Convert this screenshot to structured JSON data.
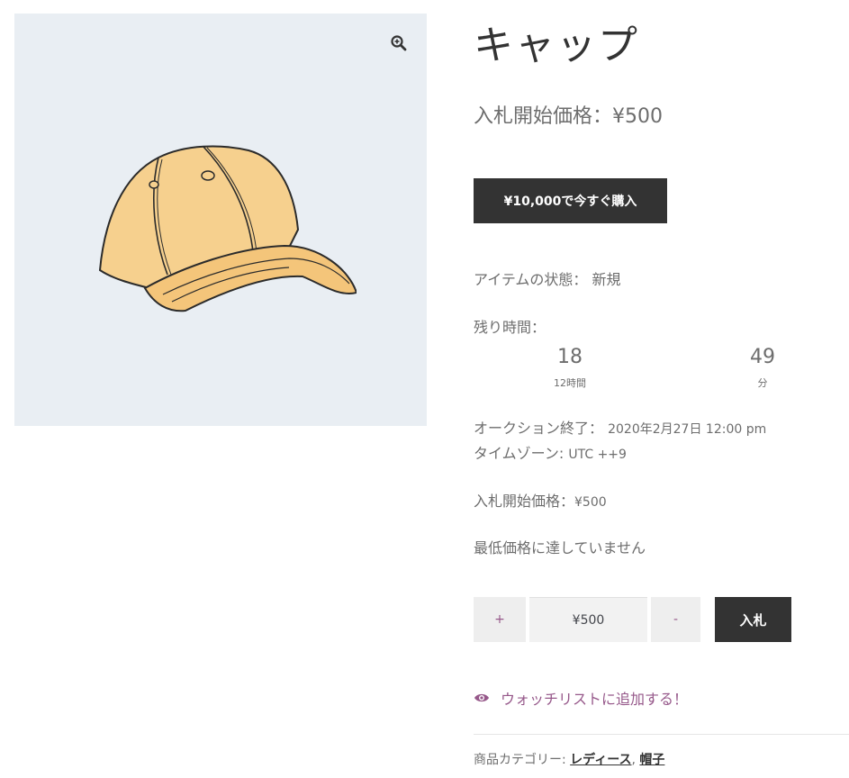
{
  "product": {
    "title": "キャップ",
    "start_price_label": "入札開始価格：",
    "start_price": "¥500",
    "buy_now_label": "¥10,000で今すぐ購入",
    "condition_label": "アイテムの状態：",
    "condition_value": "新規",
    "time_left_label": "残り時間：",
    "countdown": {
      "hours_value": "18",
      "hours_unit": "12時間",
      "minutes_value": "49",
      "minutes_unit": "分"
    },
    "auction_end_label": "オークション終了：",
    "auction_end_value": "2020年2月27日 12:00 pm",
    "timezone_label": "タイムゾーン:",
    "timezone_value": "UTC ++9",
    "start_price_small_label": "入札開始価格：",
    "start_price_small_value": "¥500",
    "reserve_text": "最低価格に達していません"
  },
  "bid_form": {
    "plus_label": "+",
    "bid_value": "¥500",
    "minus_label": "-",
    "bid_button_label": "入札"
  },
  "watchlist": {
    "label": "ウォッチリストに追加する！",
    "icon": "eye-icon"
  },
  "meta": {
    "categories_label": "商品カテゴリー:",
    "category_1": "レディース",
    "separator": ",",
    "category_2": "帽子"
  },
  "colors": {
    "accent": "#96588a",
    "button_dark": "#333333",
    "gallery_bg": "#e9eef3",
    "cap_fill": "#f6d08e"
  },
  "icons": {
    "zoom": "zoom-in-icon",
    "image": "baseball-cap-image"
  }
}
